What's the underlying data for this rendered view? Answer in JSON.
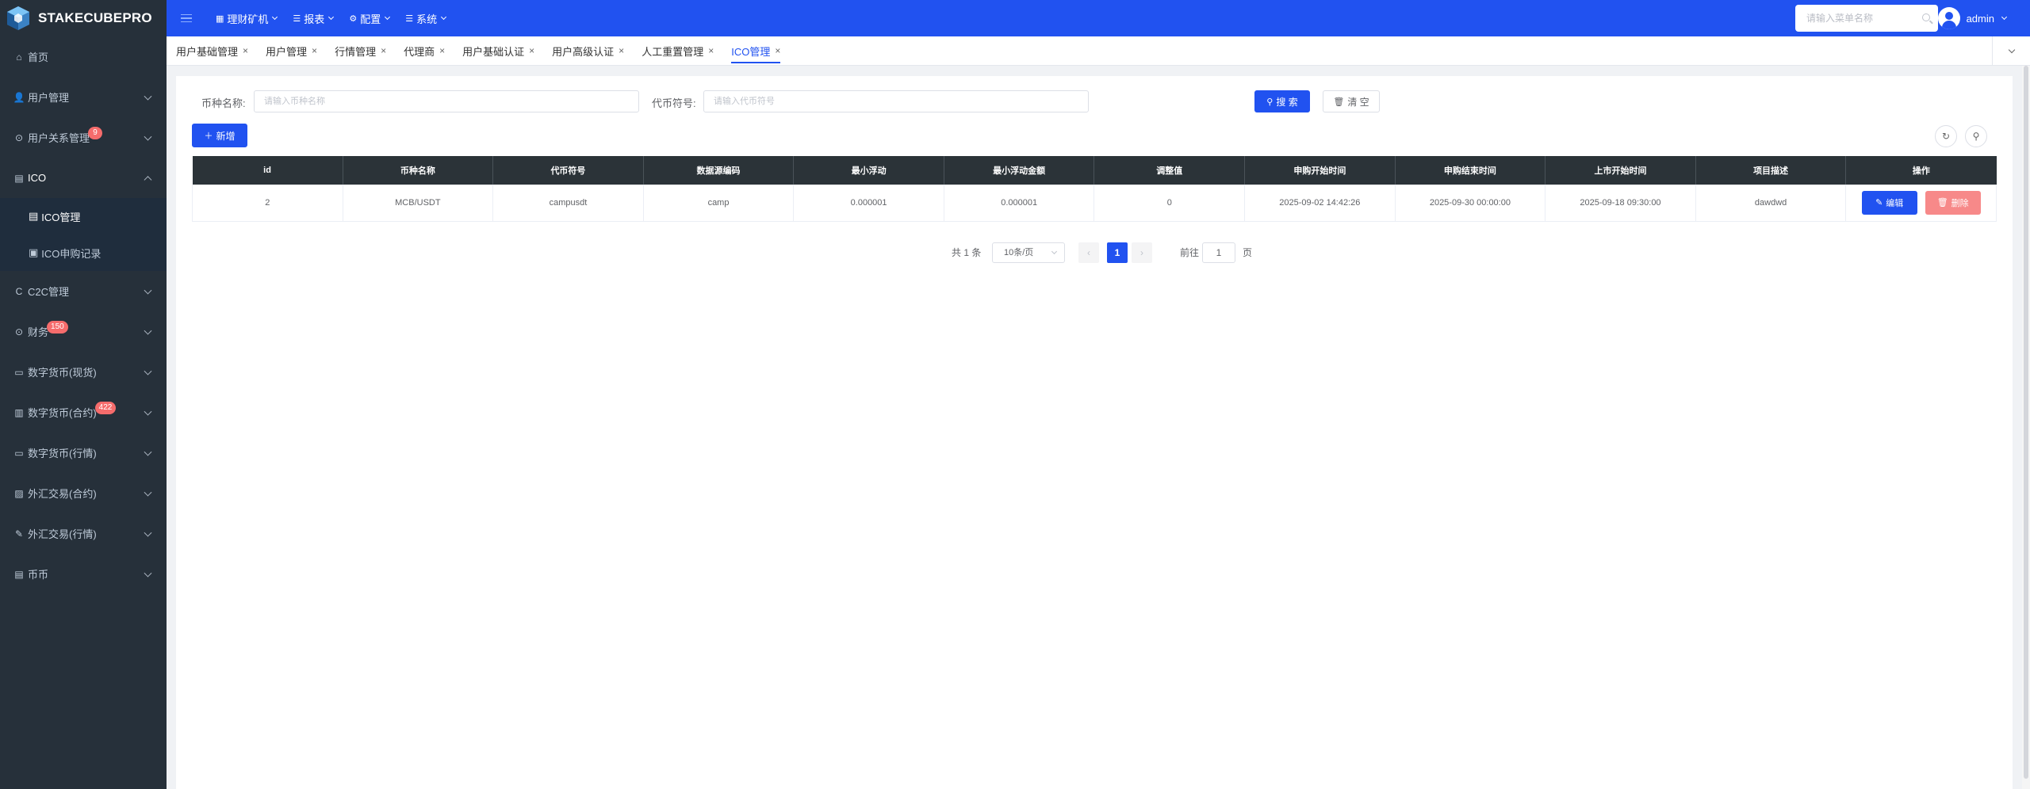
{
  "brand": {
    "name": "STAKECUBEPRO"
  },
  "topnav": {
    "items": [
      {
        "label": "理财矿机",
        "icon": "grid-icon"
      },
      {
        "label": "报表",
        "icon": "list-icon"
      },
      {
        "label": "配置",
        "icon": "gear-icon"
      },
      {
        "label": "系统",
        "icon": "list-icon"
      }
    ],
    "search_placeholder": "请输入菜单名称",
    "user": "admin"
  },
  "sidebar": {
    "items": [
      {
        "label": "首页",
        "icon": "home-icon"
      },
      {
        "label": "用户管理",
        "icon": "user-icon"
      },
      {
        "label": "用户关系管理",
        "icon": "relation-icon",
        "badge": "9"
      },
      {
        "label": "ICO",
        "icon": "document-icon"
      },
      {
        "label": "C2C管理",
        "icon": "c2c-icon"
      },
      {
        "label": "财务",
        "icon": "finance-icon",
        "badge": "150"
      },
      {
        "label": "数字货币(现货)",
        "icon": "wallet-icon"
      },
      {
        "label": "数字货币(合约)",
        "icon": "contract-icon",
        "badge": "422"
      },
      {
        "label": "数字货币(行情)",
        "icon": "market-icon"
      },
      {
        "label": "外汇交易(合约)",
        "icon": "forex-icon"
      },
      {
        "label": "外汇交易(行情)",
        "icon": "forex-market-icon"
      },
      {
        "label": "币币",
        "icon": "coin-icon"
      }
    ],
    "ico_sub": [
      {
        "label": "ICO管理"
      },
      {
        "label": "ICO申购记录"
      }
    ]
  },
  "tags": [
    {
      "label": "用户基础管理"
    },
    {
      "label": "用户管理"
    },
    {
      "label": "行情管理"
    },
    {
      "label": "代理商"
    },
    {
      "label": "用户基础认证"
    },
    {
      "label": "用户高级认证"
    },
    {
      "label": "人工重置管理"
    },
    {
      "label": "ICO管理"
    }
  ],
  "filters": {
    "coin_name_label": "币种名称:",
    "coin_name_placeholder": "请输入币种名称",
    "symbol_label": "代币符号:",
    "symbol_placeholder": "请输入代币符号",
    "search_label": "搜 索",
    "clear_label": "清 空"
  },
  "toolbar": {
    "add_label": "新增"
  },
  "table": {
    "columns": [
      "id",
      "币种名称",
      "代币符号",
      "数据源编码",
      "最小浮动",
      "最小浮动金额",
      "调整值",
      "申购开始时间",
      "申购结束时间",
      "上市开始时间",
      "项目描述",
      "操作"
    ],
    "rows": [
      {
        "cells": [
          "2",
          "MCB/USDT",
          "campusdt",
          "camp",
          "0.000001",
          "0.000001",
          "0",
          "2025-09-02 14:42:26",
          "2025-09-30 00:00:00",
          "2025-09-18 09:30:00",
          "dawdwd"
        ],
        "edit_label": "编辑",
        "delete_label": "删除"
      }
    ]
  },
  "pagination": {
    "total": "共 1 条",
    "page_size": "10条/页",
    "current": "1",
    "goto_label": "前往",
    "goto_value": "1",
    "page_suffix": "页"
  }
}
